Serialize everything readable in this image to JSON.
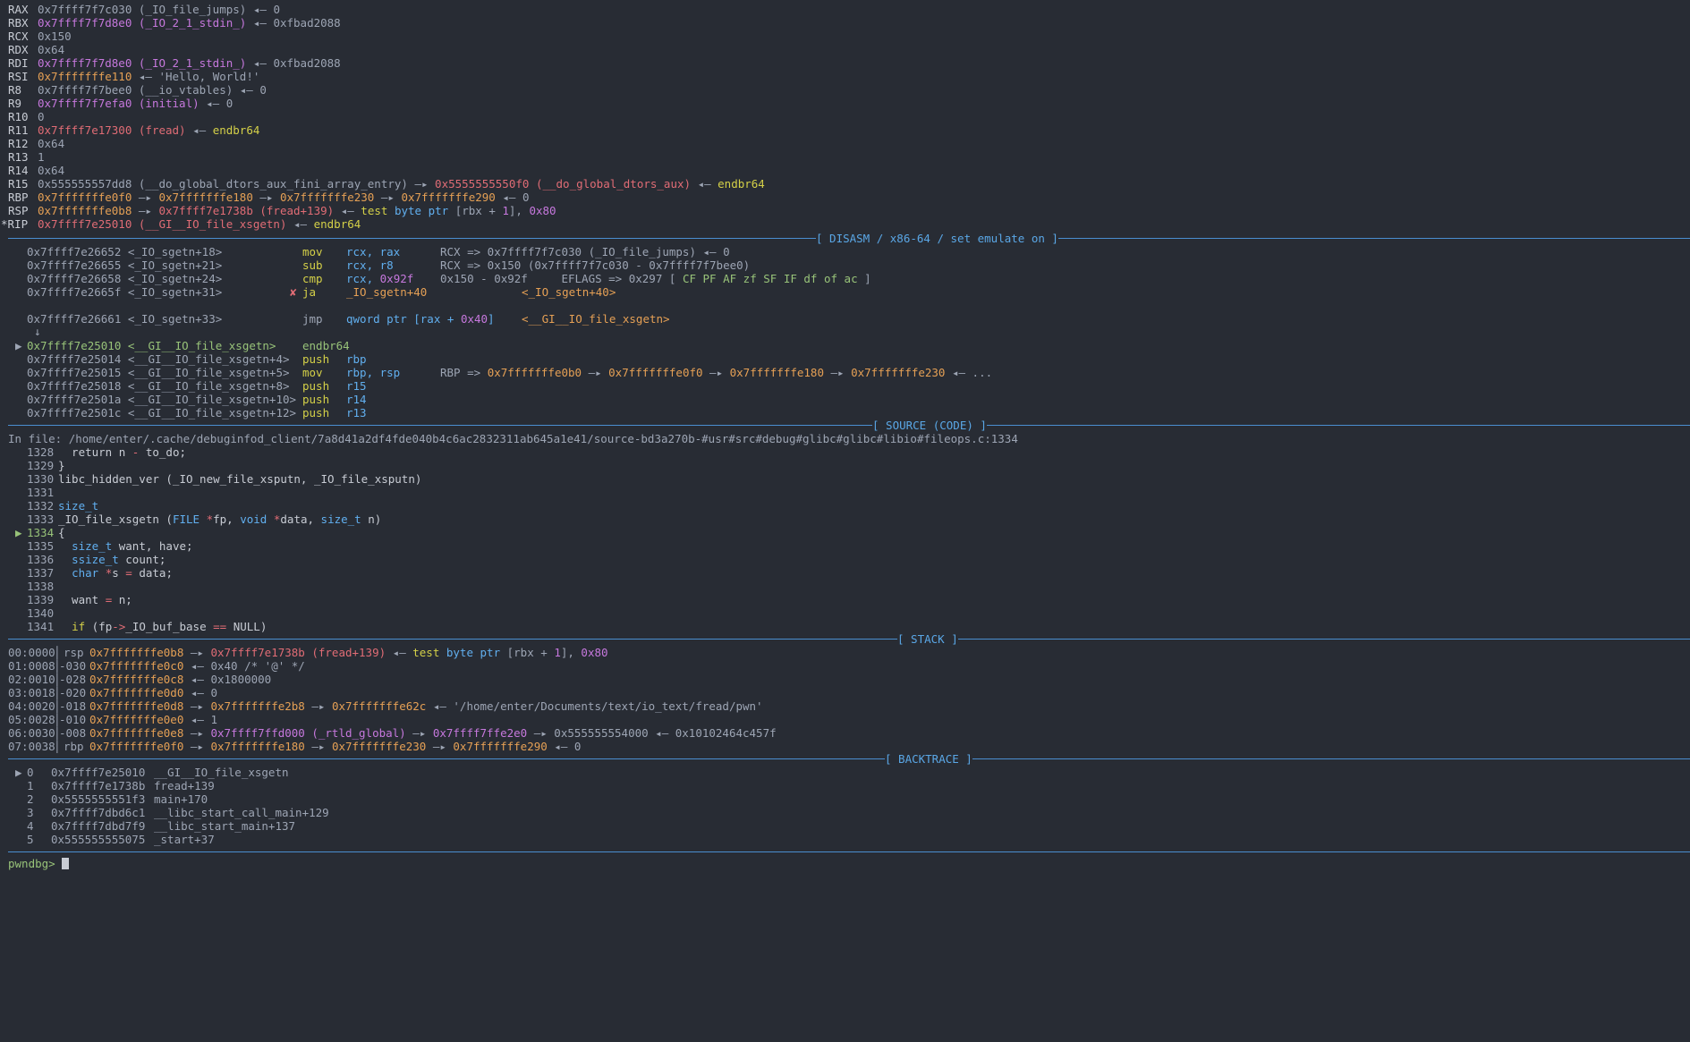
{
  "registers": {
    "rax": {
      "name": "RAX",
      "value": "0x7ffff7f7c030",
      "sym": "(_IO_file_jumps)",
      "arrow": "◂—",
      "target": "0"
    },
    "rbx": {
      "name": "RBX",
      "value": "0x7ffff7f7d8e0",
      "sym": "(_IO_2_1_stdin_)",
      "arrow": "◂—",
      "target": "0xfbad2088"
    },
    "rcx": {
      "name": "RCX",
      "value": "0x150"
    },
    "rdx": {
      "name": "RDX",
      "value": "0x64"
    },
    "rdi": {
      "name": "RDI",
      "value": "0x7ffff7f7d8e0",
      "sym": "(_IO_2_1_stdin_)",
      "arrow": "◂—",
      "target": "0xfbad2088"
    },
    "rsi": {
      "name": "RSI",
      "value": "0x7fffffffe110",
      "arrow": "◂—",
      "target": "'Hello, World!'"
    },
    "r8": {
      "name": "R8",
      "value": "0x7ffff7f7bee0",
      "sym": "(__io_vtables)",
      "arrow": "◂—",
      "target": "0"
    },
    "r9": {
      "name": "R9",
      "value": "0x7ffff7f7efa0",
      "sym": "(initial)",
      "arrow": "◂—",
      "target": "0"
    },
    "r10": {
      "name": "R10",
      "value": "0"
    },
    "r11": {
      "name": "R11",
      "value": "0x7ffff7e17300",
      "sym": "(fread)",
      "arrow": "◂—",
      "target": "endbr64"
    },
    "r12": {
      "name": "R12",
      "value": "0x64"
    },
    "r13": {
      "name": "R13",
      "value": "1"
    },
    "r14": {
      "name": "R14",
      "value": "0x64"
    },
    "r15": {
      "name": "R15",
      "value": "0x555555557dd8",
      "sym": "(__do_global_dtors_aux_fini_array_entry)",
      "arrow1": "—▸",
      "t1": "0x5555555550f0",
      "t1sym": "(__do_global_dtors_aux)",
      "arrow2": "◂—",
      "t2": "endbr64"
    },
    "rbp": {
      "name": "RBP",
      "value": "0x7fffffffe0f0",
      "a1": "—▸",
      "v1": "0x7fffffffe180",
      "a2": "—▸",
      "v2": "0x7fffffffe230",
      "a3": "—▸",
      "v3": "0x7fffffffe290",
      "a4": "◂—",
      "v4": "0"
    },
    "rsp": {
      "name": "RSP",
      "value": "0x7fffffffe0b8",
      "a1": "—▸",
      "v1": "0x7ffff7e1738b",
      "v1sym": "(fread+139)",
      "a2": "◂—",
      "ins": "test",
      "opnd1": "byte ptr",
      "opnd2": "[rbx + ",
      "opnd3": "1",
      "opnd4": "], ",
      "opnd5": "0x80"
    },
    "rip": {
      "name": "*RIP",
      "value": "0x7ffff7e25010",
      "sym": "(__GI__IO_file_xsgetn)",
      "arrow": "◂—",
      "target": "endbr64"
    }
  },
  "sections": {
    "disasm": "[ DISASM / x86-64 / set emulate on ]",
    "source": "[ SOURCE (CODE) ]",
    "stack": "[ STACK ]",
    "backtrace": "[ BACKTRACE ]"
  },
  "disasm": [
    {
      "addr": "0x7ffff7e26652 <_IO_sgetn+18>",
      "mn": "mov",
      "ops": "rcx, rax",
      "cm": "RCX => 0x7ffff7f7c030 (_IO_file_jumps) ◂— 0"
    },
    {
      "addr": "0x7ffff7e26655 <_IO_sgetn+21>",
      "mn": "sub",
      "ops": "rcx, r8",
      "cm": "RCX => 0x150 (0x7ffff7f7c030 - 0x7ffff7f7bee0)"
    },
    {
      "addr": "0x7ffff7e26658 <_IO_sgetn+24>",
      "mn": "cmp",
      "ops_a": "rcx, ",
      "ops_b": "0x92f",
      "cm_a": "0x150 - 0x92f     EFLAGS => 0x297 [ ",
      "flags": "CF PF AF zf SF IF df of ac",
      "cm_b": " ]"
    },
    {
      "addr": "0x7ffff7e2665f <_IO_sgetn+31>",
      "mark": "✘",
      "mn": "ja",
      "ops": "_IO_sgetn+40",
      "cm": "<_IO_sgetn+40>"
    },
    {
      "addr": "0x7ffff7e26661 <_IO_sgetn+33>",
      "mn": "jmp",
      "ops_a": "qword ptr [rax + ",
      "ops_b": "0x40",
      "ops_c": "]",
      "cm": "<__GI__IO_file_xsgetn>"
    },
    {
      "down": "↓"
    },
    {
      "cur": "▶",
      "addr": "0x7ffff7e25010 <__GI__IO_file_xsgetn>",
      "mn": "endbr64"
    },
    {
      "addr": "0x7ffff7e25014 <__GI__IO_file_xsgetn+4>",
      "mn": "push",
      "ops": "rbp"
    },
    {
      "addr": "0x7ffff7e25015 <__GI__IO_file_xsgetn+5>",
      "mn": "mov",
      "ops": "rbp, rsp",
      "cm_a": "RBP => ",
      "c1": "0x7fffffffe0b0",
      "c2": " —▸ ",
      "c3": "0x7fffffffe0f0",
      "c4": " —▸ ",
      "c5": "0x7fffffffe180",
      "c6": " —▸ ",
      "c7": "0x7fffffffe230",
      "c8": " ◂— ..."
    },
    {
      "addr": "0x7ffff7e25018 <__GI__IO_file_xsgetn+8>",
      "mn": "push",
      "ops": "r15"
    },
    {
      "addr": "0x7ffff7e2501a <__GI__IO_file_xsgetn+10>",
      "mn": "push",
      "ops": "r14"
    },
    {
      "addr": "0x7ffff7e2501c <__GI__IO_file_xsgetn+12>",
      "mn": "push",
      "ops": "r13"
    }
  ],
  "source": {
    "file": "In file: /home/enter/.cache/debuginfod_client/7a8d41a2df4fde040b4c6ac2832311ab645a1e41/source-bd3a270b-#usr#src#debug#glibc#glibc#libio#fileops.c:1334",
    "lines": [
      {
        "no": "1328",
        "t1": "  return n ",
        "op": "-",
        "t2": " to_do;"
      },
      {
        "no": "1329",
        "t1": "}"
      },
      {
        "no": "1330",
        "t1": "libc_hidden_ver (_IO_new_file_xsputn, _IO_file_xsputn)"
      },
      {
        "no": "1331",
        "t1": ""
      },
      {
        "no": "1332",
        "ty": "size_t"
      },
      {
        "no": "1333",
        "t1": "_IO_file_xsgetn (",
        "k1": "FILE",
        "t2": " ",
        "s1": "*",
        "t3": "fp, ",
        "k2": "void",
        "t4": " ",
        "s2": "*",
        "t5": "data, ",
        "k3": "size_t",
        "t6": " n)"
      },
      {
        "no": "1334",
        "cur": "▶",
        "t1": "{"
      },
      {
        "no": "1335",
        "t0": "  ",
        "ty": "size_t",
        "t1": " want, have;"
      },
      {
        "no": "1336",
        "t0": "  ",
        "ty": "ssize_t",
        "t1": " count;"
      },
      {
        "no": "1337",
        "t0": "  ",
        "ty": "char",
        "t1": " ",
        "s": "*",
        "t2": "s ",
        "eq": "=",
        "t3": " data;"
      },
      {
        "no": "1338",
        "t1": ""
      },
      {
        "no": "1339",
        "t1": "  want ",
        "eq": "=",
        "t2": " n;"
      },
      {
        "no": "1340",
        "t1": ""
      },
      {
        "no": "1341",
        "t0": "  ",
        "kw": "if",
        "t1": " (fp",
        "ar": "->",
        "t2": "_IO_buf_base ",
        "eq": "==",
        "t3": " NULL)"
      }
    ]
  },
  "stack": [
    {
      "idx": "00:0000",
      "reg": "rsp",
      "addr": "0x7fffffffe0b8",
      "a1": " —▸ ",
      "v1": "0x7ffff7e1738b (fread+139)",
      "a2": " ◂— ",
      "ins": "test",
      "o1": " byte ptr ",
      "o2": "[rbx + ",
      "o3": "1",
      "o4": "], ",
      "o5": "0x80"
    },
    {
      "idx": "01:0008",
      "reg": "-030",
      "addr": "0x7fffffffe0c0",
      "rest": " ◂— 0x40 /* '@' */"
    },
    {
      "idx": "02:0010",
      "reg": "-028",
      "addr": "0x7fffffffe0c8",
      "rest": " ◂— 0x1800000"
    },
    {
      "idx": "03:0018",
      "reg": "-020",
      "addr": "0x7fffffffe0d0",
      "rest": " ◂— 0"
    },
    {
      "idx": "04:0020",
      "reg": "-018",
      "addr": "0x7fffffffe0d8",
      "a1": " —▸ ",
      "v1": "0x7fffffffe2b8",
      "a2": " —▸ ",
      "v2": "0x7fffffffe62c",
      "tail": " ◂— '/home/enter/Documents/text/io_text/fread/pwn'"
    },
    {
      "idx": "05:0028",
      "reg": "-010",
      "addr": "0x7fffffffe0e0",
      "rest": " ◂— 1"
    },
    {
      "idx": "06:0030",
      "reg": "-008",
      "addr": "0x7fffffffe0e8",
      "a1": " —▸ ",
      "p1": "0x7ffff7ffd000 (_rtld_global)",
      "a2": " —▸ ",
      "p2": "0x7ffff7ffe2e0",
      "tail": " —▸ 0x555555554000 ◂— 0x10102464c457f"
    },
    {
      "idx": "07:0038",
      "reg": "rbp",
      "addr": "0x7fffffffe0f0",
      "a1": " —▸ ",
      "v1": "0x7fffffffe180",
      "a2": " —▸ ",
      "v2": "0x7fffffffe230",
      "a3": " —▸ ",
      "v3": "0x7fffffffe290",
      "tail": " ◂— 0"
    }
  ],
  "backtrace": [
    {
      "cur": "▶",
      "n": "0",
      "addr": "0x7ffff7e25010",
      "fn": "__GI__IO_file_xsgetn"
    },
    {
      "n": "1",
      "addr": "0x7ffff7e1738b",
      "fn": "fread+139"
    },
    {
      "n": "2",
      "addr": "0x5555555551f3",
      "fn": "main+170"
    },
    {
      "n": "3",
      "addr": "0x7ffff7dbd6c1",
      "fn": "__libc_start_call_main+129"
    },
    {
      "n": "4",
      "addr": "0x7ffff7dbd7f9",
      "fn": "__libc_start_main+137"
    },
    {
      "n": "5",
      "addr": "0x555555555075",
      "fn": "_start+37"
    }
  ],
  "prompt": "pwndbg>",
  "colors": {
    "background": "#282c34",
    "rule": "#4a8ed0",
    "heading": "#5aa7e6"
  }
}
